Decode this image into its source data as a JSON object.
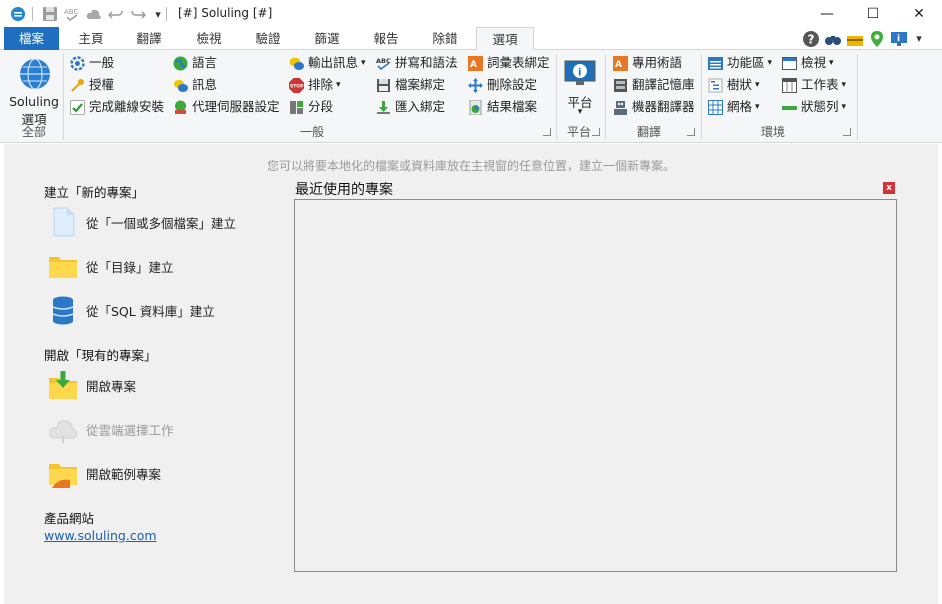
{
  "window": {
    "title": "[#] Soluling [#]",
    "minimize_glyph": "—",
    "maximize_glyph": "☐",
    "close_glyph": "✕"
  },
  "qat": {
    "icons": [
      "soluling-logo-icon",
      "save-icon",
      "spell-check-icon",
      "cloud-icon",
      "undo-icon",
      "redo-icon",
      "customize-qat-icon"
    ],
    "customize_glyph": "▾"
  },
  "tabs": [
    "檔案",
    "主頁",
    "翻譯",
    "檢視",
    "驗證",
    "篩選",
    "報告",
    "除錯",
    "選項"
  ],
  "active_tab": "選項",
  "ribbon": {
    "soluling_options": {
      "line1": "Soluling",
      "line2": "選項"
    },
    "group_general_label": "一般",
    "group_all_label": "全部",
    "col1": [
      "一般",
      "授權",
      "完成離線安裝"
    ],
    "col2": [
      "語言",
      "訊息",
      "代理伺服器設定"
    ],
    "col3": [
      "輸出訊息",
      "排除",
      "分段"
    ],
    "col4": [
      "拼寫和語法",
      "檔案綁定",
      "匯入綁定"
    ],
    "col5": [
      "詞彙表綁定",
      "刪除設定",
      "結果檔案"
    ],
    "platform": {
      "label": "平台",
      "group_label": "平台"
    },
    "translate": {
      "items": [
        "專用術語",
        "翻譯記憶庫",
        "機器翻譯器"
      ],
      "group_label": "翻譯"
    },
    "environment": {
      "col1": [
        "功能區",
        "樹狀",
        "網格"
      ],
      "col2": [
        "檢視",
        "工作表",
        "狀態列"
      ],
      "group_label": "環境"
    }
  },
  "colors": {
    "accent": "#1e6fc0",
    "link": "#1a5fb4",
    "close_red": "#d13438"
  },
  "main": {
    "hint": "您可以將要本地化的檔案或資料庫放在主視窗的任意位置，建立一個新專案。",
    "create_header": "建立「新的專案」",
    "create_items": [
      "從「一個或多個檔案」建立",
      "從「目錄」建立",
      "從「SQL 資料庫」建立"
    ],
    "open_header": "開啟「現有的專案」",
    "open_items": [
      "開啟專案",
      "從雲端選擇工作",
      "開啟範例專案"
    ],
    "website_header": "產品網站",
    "website_link": "www.soluling.com",
    "recent_title": "最近使用的專案",
    "recent_close": "x"
  }
}
